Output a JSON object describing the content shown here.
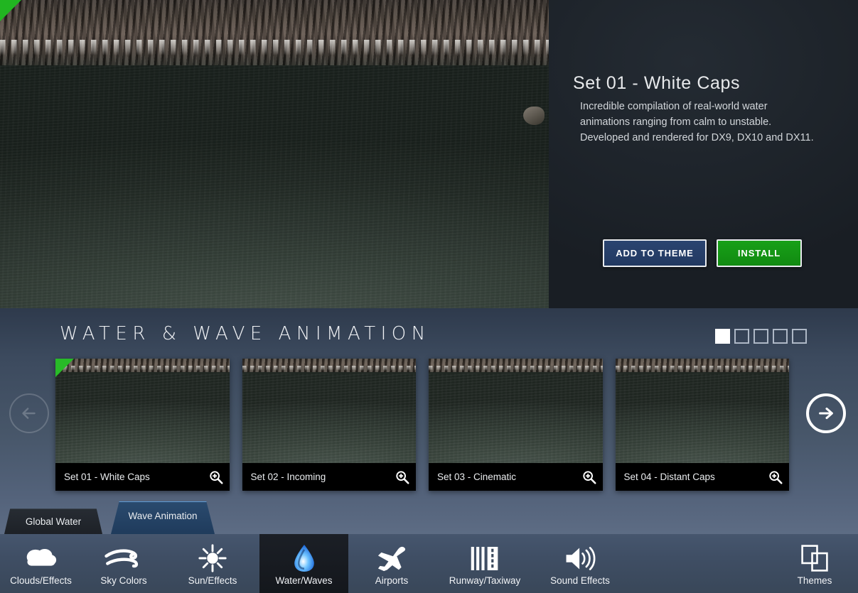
{
  "hero": {
    "detail": {
      "title": "Set 01 - White Caps",
      "description": "Incredible compilation of real-world water animations ranging from calm to unstable. Developed and rendered for DX9, DX10 and DX11.",
      "add_button_label": "ADD TO THEME",
      "install_button_label": "INSTALL"
    },
    "preview_icon": "water-preview-image",
    "installed_flag_color": "#21b521"
  },
  "carousel": {
    "title": "WATER & WAVE ANIMATION",
    "pager": {
      "total": 5,
      "active_index": 0
    },
    "prev_arrow_icon": "arrow-left-icon",
    "next_arrow_icon": "arrow-right-icon",
    "prev_enabled": false,
    "next_enabled": true,
    "items": [
      {
        "label": "Set 01 - White Caps",
        "zoom_icon": "magnifier-plus-icon",
        "selected": true
      },
      {
        "label": "Set 02 - Incoming",
        "zoom_icon": "magnifier-plus-icon",
        "selected": false
      },
      {
        "label": "Set 03 - Cinematic",
        "zoom_icon": "magnifier-plus-icon",
        "selected": false
      },
      {
        "label": "Set 04 - Distant Caps",
        "zoom_icon": "magnifier-plus-icon",
        "selected": false
      }
    ]
  },
  "subtabs": [
    {
      "label": "Global Water",
      "active": false
    },
    {
      "label": "Wave Animation",
      "active": true
    }
  ],
  "bottomnav": {
    "items": [
      {
        "label": "Clouds/Effects",
        "icon": "cloud-icon",
        "active": false
      },
      {
        "label": "Sky Colors",
        "icon": "wind-icon",
        "active": false
      },
      {
        "label": "Sun/Effects",
        "icon": "sun-icon",
        "active": false
      },
      {
        "label": "Water/Waves",
        "icon": "water-drop-icon",
        "active": true
      },
      {
        "label": "Airports",
        "icon": "airplane-icon",
        "active": false
      },
      {
        "label": "Runway/Taxiway",
        "icon": "runway-icon",
        "active": false
      },
      {
        "label": "Sound Effects",
        "icon": "speaker-icon",
        "active": false
      }
    ],
    "right_item": {
      "label": "Themes",
      "icon": "themes-icon",
      "active": false
    }
  },
  "colors": {
    "accent_install": "#18a018",
    "accent_add": "#2a4470",
    "panel_bg": "#1e242b",
    "carousel_bg": "#475669",
    "nav_bg": "#3f4e64",
    "active_nav_bg": "#1b1f26"
  }
}
